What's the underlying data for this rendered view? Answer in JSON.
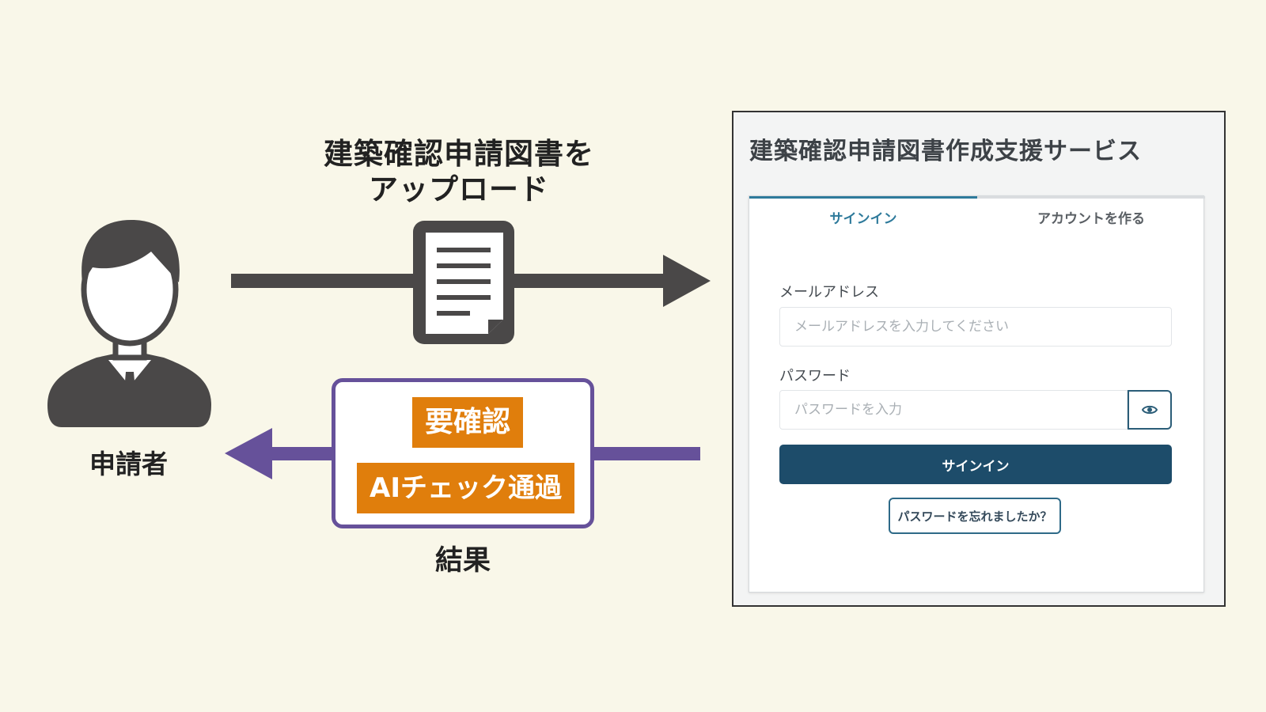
{
  "upload_caption_line1": "建築確認申請図書を",
  "upload_caption_line2": "アップロード",
  "applicant_label": "申請者",
  "result_label": "結果",
  "result_badges": {
    "needs_check": "要確認",
    "ai_check_passed": "AIチェック通過"
  },
  "icons": {
    "applicant": "person-in-suit-icon",
    "document": "document-icon",
    "password_toggle": "eye-icon"
  },
  "colors": {
    "upload_arrow": "#4a4848",
    "result_arrow": "#66519a",
    "badge": "#e07e0c",
    "signin_button": "#1d4c6a",
    "active_tab": "#2e7a9b"
  },
  "login": {
    "service_title": "建築確認申請図書作成支援サービス",
    "tabs": [
      "サインイン",
      "アカウントを作る"
    ],
    "email_label": "メールアドレス",
    "email_placeholder": "メールアドレスを入力してください",
    "password_label": "パスワード",
    "password_placeholder": "パスワードを入力",
    "signin_button": "サインイン",
    "forgot_button": "パスワードを忘れましたか？"
  }
}
